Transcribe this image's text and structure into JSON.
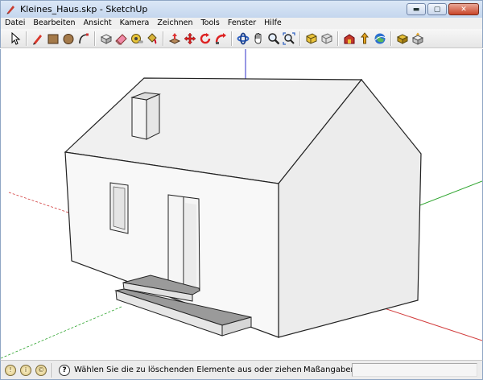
{
  "window": {
    "title": "Kleines_Haus.skp - SketchUp",
    "minimize_glyph": "▬",
    "maximize_glyph": "▢",
    "close_glyph": "✕"
  },
  "menu": [
    "Datei",
    "Bearbeiten",
    "Ansicht",
    "Kamera",
    "Zeichnen",
    "Tools",
    "Fenster",
    "Hilfe"
  ],
  "toolbar_groups": [
    [
      "select-tool-icon"
    ],
    [
      "pencil-line-tool-icon",
      "rectangle-tool-icon",
      "circle-tool-icon",
      "arc-tool-icon"
    ],
    [
      "make-component-icon",
      "eraser-tool-icon",
      "tape-measure-tool-icon",
      "paint-bucket-tool-icon"
    ],
    [
      "push-pull-tool-icon",
      "move-tool-icon",
      "rotate-tool-icon",
      "follow-me-tool-icon"
    ],
    [
      "orbit-tool-icon",
      "pan-tool-icon",
      "zoom-tool-icon",
      "zoom-extents-icon"
    ],
    [
      "previous-view-icon",
      "next-view-icon"
    ],
    [
      "get-models-icon",
      "share-model-icon",
      "google-earth-icon"
    ],
    [
      "get-components-icon",
      "share-component-icon"
    ]
  ],
  "colors": {
    "axis_red": "#d23c3c",
    "axis_green": "#2fa52f",
    "axis_blue": "#2f2fc8",
    "wall_front": "#f7f7f7",
    "wall_side": "#ececec",
    "roof": "#f0f0f0",
    "step_top": "#9a9a9a"
  },
  "status": {
    "icon_1": "!",
    "icon_2": "i",
    "icon_3": "©",
    "help_glyph": "?",
    "text": "Wählen Sie die zu löschenden Elemente aus oder ziehen",
    "measure_label": "Maßangaben",
    "measure_value": ""
  }
}
